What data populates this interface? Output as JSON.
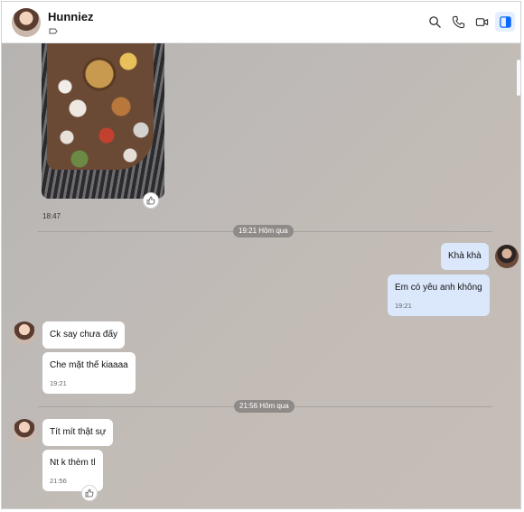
{
  "contact": {
    "name": "Hunniez",
    "tag_icon": "tag-icon"
  },
  "header_actions": [
    {
      "name": "search-icon"
    },
    {
      "name": "phone-icon"
    },
    {
      "name": "video-camera-icon"
    },
    {
      "name": "sidebar-panel-icon",
      "active": true
    }
  ],
  "colors": {
    "accent": "#0a68ff",
    "outgoing_bubble": "#dbe8fb",
    "incoming_bubble": "#ffffff",
    "divider_pill": "#8f8b88"
  },
  "messages": {
    "photo_time": "18:47",
    "divider_1": "19:21 Hôm qua",
    "out_1": "Khà khà",
    "out_2": "Em có yêu anh không",
    "out_2_time": "19:21",
    "in_1": "Ck say chưa đấy",
    "in_2": "Che mặt thế kiaaaa",
    "in_2_time": "19:21",
    "divider_2": "21:56 Hôm qua",
    "in_3": "Tít mít thật sự",
    "in_4": "Nt k thèm tl",
    "in_4_time": "21:56"
  }
}
